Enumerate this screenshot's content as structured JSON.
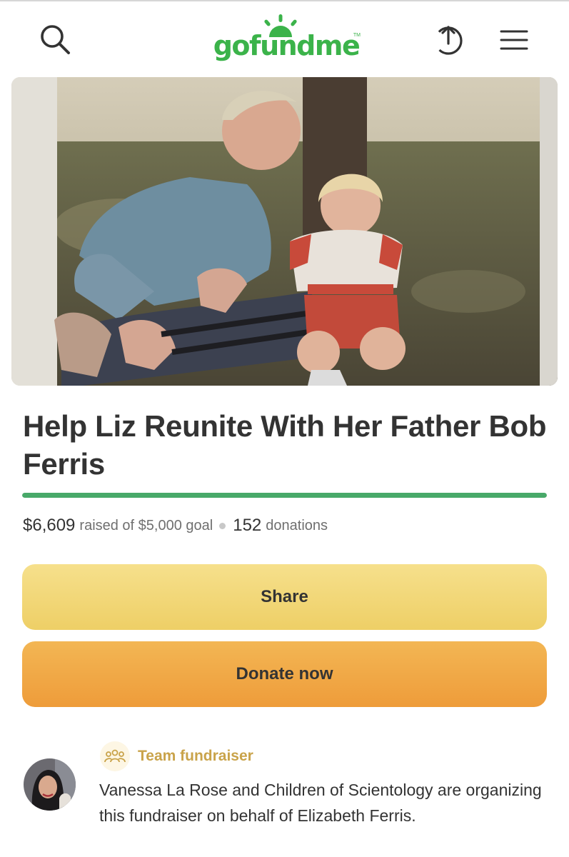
{
  "header": {
    "logo_text": "gofundme",
    "logo_tm": "TM"
  },
  "icons": {
    "search": "search-icon",
    "share": "share-upload-icon",
    "menu": "hamburger-menu-icon"
  },
  "campaign": {
    "title": "Help Liz Reunite With Her Father Bob Ferris",
    "raised": "$6,609",
    "raised_of_goal": "raised of $5,000 goal",
    "donation_count": "152",
    "donations_label": "donations",
    "progress_fraction": 1.0
  },
  "buttons": {
    "share_label": "Share",
    "donate_label": "Donate now"
  },
  "organizer": {
    "badge_label": "Team fundraiser",
    "description": "Vanessa La Rose and Children of Scientology are organizing this fundraiser on behalf of Elizabeth Ferris."
  },
  "colors": {
    "brand_green": "#3bb34a",
    "progress_green": "#48a969",
    "share_yellow": "#f2d979",
    "donate_orange": "#f0a847",
    "team_gold": "#c9a34a"
  }
}
